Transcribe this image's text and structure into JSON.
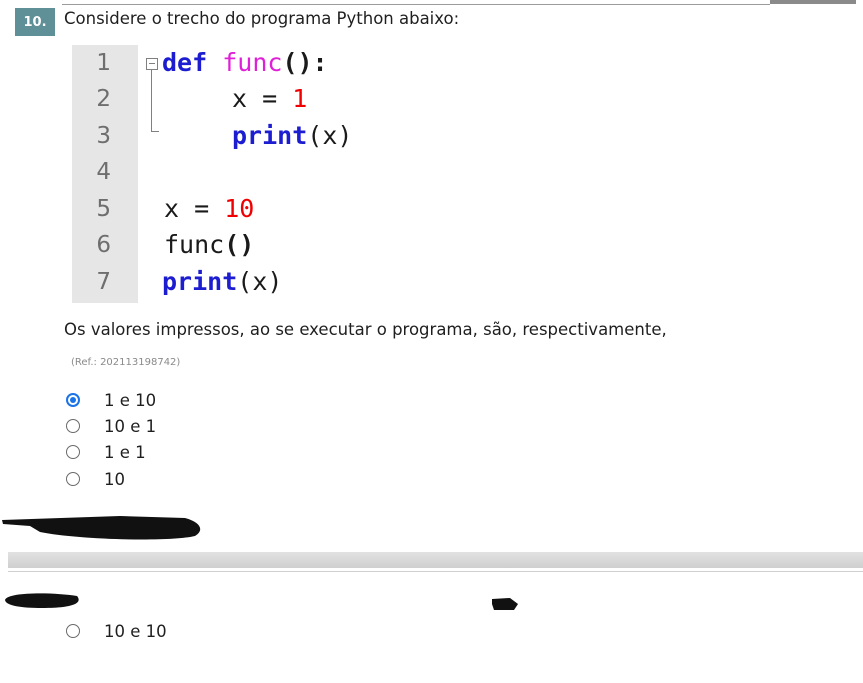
{
  "question": {
    "number": "10.",
    "text": "Considere o trecho do programa Python abaixo:",
    "prompt": "Os valores impressos, ao se executar o programa, são, respectivamente,",
    "ref": "(Ref.: 202113198742)"
  },
  "code": {
    "line_numbers": [
      "1",
      "2",
      "3",
      "4",
      "5",
      "6",
      "7"
    ],
    "lines": [
      {
        "kw": "def",
        "fn": "func",
        "paren": "():"
      },
      {
        "text": "x = ",
        "num": "1"
      },
      {
        "kw": "print",
        "rest": "(x)"
      },
      {},
      {
        "text": "x = ",
        "num": "10"
      },
      {
        "text": "func",
        "paren": "()"
      },
      {
        "kw": "print",
        "rest": "(x)"
      }
    ]
  },
  "options": [
    {
      "label": "1 e 10",
      "selected": true
    },
    {
      "label": "10 e 1",
      "selected": false
    },
    {
      "label": "1 e 1",
      "selected": false
    },
    {
      "label": "10",
      "selected": false
    },
    {
      "label": "10 e 10",
      "selected": false
    }
  ],
  "colors": {
    "badge": "#5f8f97",
    "keyword": "#1c1cd1",
    "function": "#e020d8",
    "number": "#f00000",
    "radio_selected": "#1a73e8"
  }
}
